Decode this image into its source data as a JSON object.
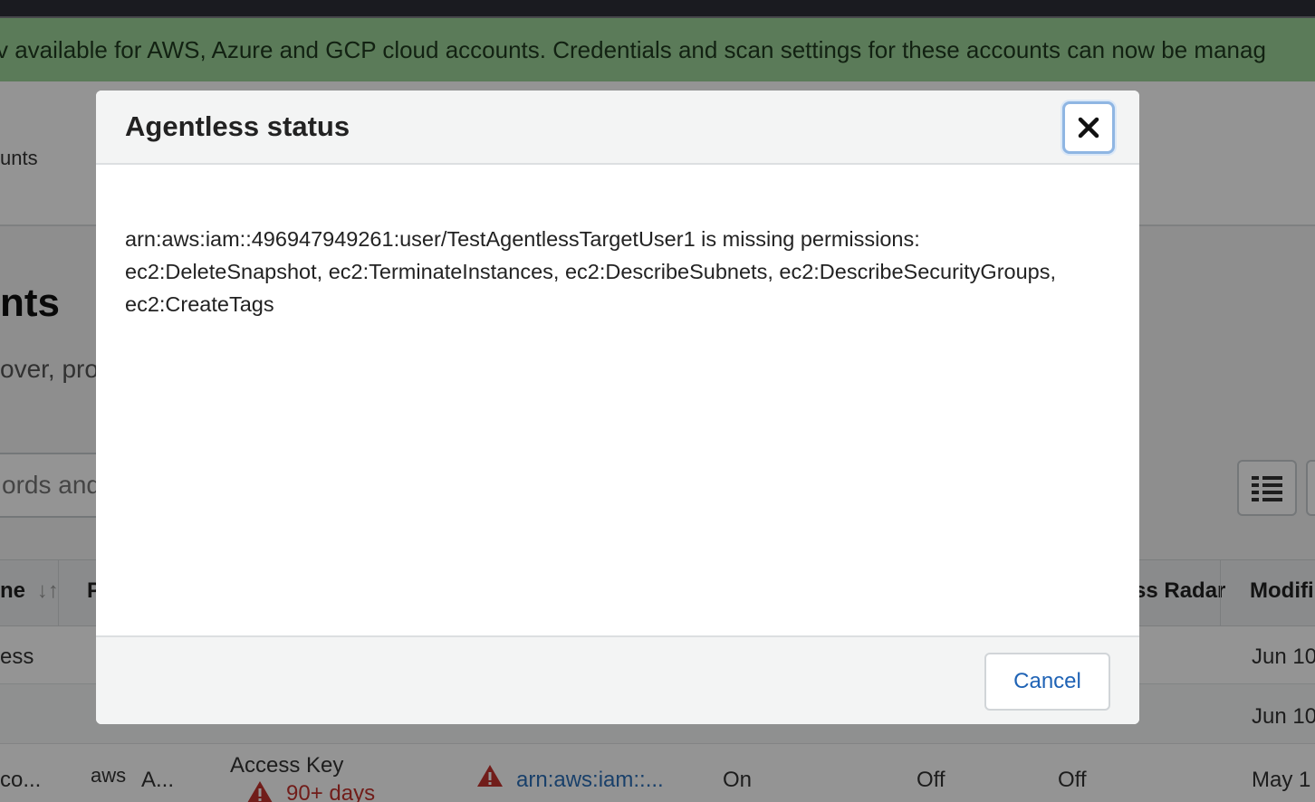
{
  "banner": {
    "text": "v available for AWS, Azure and GCP cloud accounts. Credentials and scan settings for these accounts can now be manag"
  },
  "subnav": {
    "tab_label": "unts"
  },
  "page": {
    "heading": "nts",
    "description": "over, pro",
    "search_placeholder": "ords and a"
  },
  "table": {
    "headers": [
      "ne",
      "P",
      "ss Radar",
      "Modifi"
    ],
    "rows": [
      {
        "name": "ess",
        "modified": "Jun 10"
      },
      {
        "name": "",
        "modified": "Jun 10"
      },
      {
        "name": "co...",
        "provider_logo": "aws",
        "account": "A...",
        "credential_type": "Access Key",
        "credential_age": "90+ days",
        "arn": "arn:aws:iam::...",
        "col_on": "On",
        "col_off_1": "Off",
        "col_off_2": "Off",
        "modified": "May 1"
      }
    ]
  },
  "modal": {
    "title": "Agentless status",
    "close_icon": "close-x-icon",
    "message": "arn:aws:iam::496947949261:user/TestAgentlessTargetUser1 is missing permissions: ec2:DeleteSnapshot, ec2:TerminateInstances, ec2:DescribeSubnets, ec2:DescribeSecurityGroups, ec2:CreateTags",
    "cancel_label": "Cancel"
  },
  "colors": {
    "banner_bg": "#9ed59a",
    "link": "#2c6fb7",
    "warning": "#c3322d",
    "focus_ring": "#8fb6e3"
  }
}
